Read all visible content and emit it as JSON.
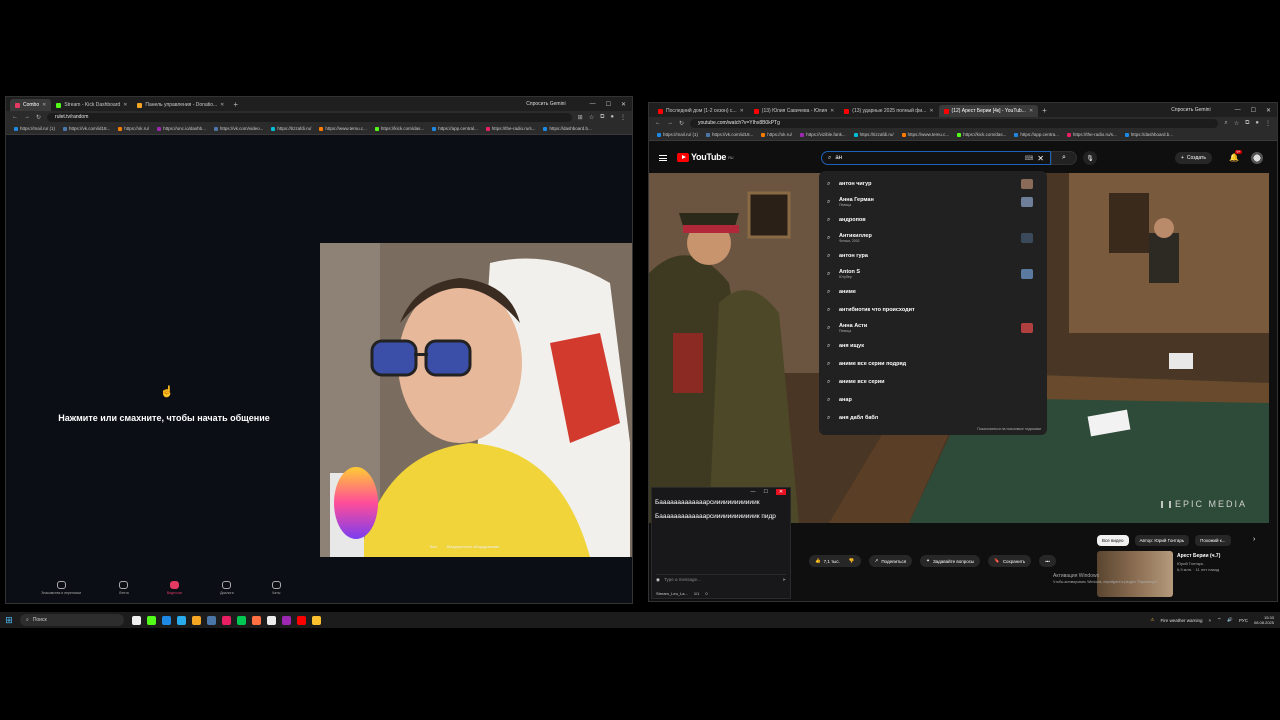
{
  "left_browser": {
    "tabs": [
      {
        "label": "Combo",
        "color": "#e23a63",
        "active": true
      },
      {
        "label": "Stream - Kick Dashboard",
        "color": "#53fc18",
        "active": false
      },
      {
        "label": "Панель управления - Donatio...",
        "color": "#f5a623",
        "active": false
      }
    ],
    "new_tab": "+",
    "gemini": "Спросить Gemini",
    "url": "rulet.tv/random",
    "bookmarks": [
      {
        "label": "https://mail.ru/ (1)",
        "color": "#1e88e5"
      },
      {
        "label": "https://vk.com/id18...",
        "color": "#4a76a8"
      },
      {
        "label": "https://ok.ru/",
        "color": "#f57c00"
      },
      {
        "label": "https://unc.io/dashb...",
        "color": "#9c27b0"
      },
      {
        "label": "https://vk.com/video...",
        "color": "#4a76a8"
      },
      {
        "label": "https://tizzafdi.ru/",
        "color": "#00bcd4"
      },
      {
        "label": "https://www.temu.c...",
        "color": "#ff7a00"
      },
      {
        "label": "https://kick.com/das...",
        "color": "#53fc18"
      },
      {
        "label": "https://app.central...",
        "color": "#1e88e5"
      },
      {
        "label": "https://the-radio.ru/s...",
        "color": "#e91e63"
      },
      {
        "label": "https://dashboard.b...",
        "color": "#1e88e5"
      }
    ],
    "hand_glyph": "☝",
    "prompt": "Нажмите или смахните, чтобы начать общение",
    "nav": [
      {
        "label": "Знакомства и переписки",
        "active": false
      },
      {
        "label": "Лента",
        "active": false
      },
      {
        "label": "Видеочат",
        "active": true
      },
      {
        "label": "Диалоги",
        "active": false
      },
      {
        "label": "Чаты",
        "active": false
      }
    ],
    "cam_pill": [
      "Все",
      "Медицинское оборудование"
    ]
  },
  "right_browser": {
    "tabs": [
      {
        "label": "Последний дом (1-2 сезон) с...",
        "color": "#ff0000",
        "active": false
      },
      {
        "label": "(13) Юлия Савичева - Юлия",
        "color": "#ff0000",
        "active": false
      },
      {
        "label": "(13) ударные 2025 полный фи...",
        "color": "#ff0000",
        "active": false
      },
      {
        "label": "(12) Арест Берии [4к] - YouTub...",
        "color": "#ff0000",
        "active": true
      }
    ],
    "new_tab": "+",
    "gemini": "Спросить Gemini",
    "url": "youtube.com/watch?v=YIhx8B0kPTg",
    "bookmarks": [
      {
        "label": "https://mail.ru/ (1)",
        "color": "#1e88e5"
      },
      {
        "label": "https://vk.com/id18...",
        "color": "#4a76a8"
      },
      {
        "label": "https://ok.ru/",
        "color": "#f57c00"
      },
      {
        "label": "https://vizible.fank...",
        "color": "#9c27b0"
      },
      {
        "label": "https://tizzafdi.ru/",
        "color": "#00bcd4"
      },
      {
        "label": "https://www.temu.c...",
        "color": "#ff7a00"
      },
      {
        "label": "https://kick.com/das...",
        "color": "#53fc18"
      },
      {
        "label": "https://app.centra...",
        "color": "#1e88e5"
      },
      {
        "label": "https://the-radio.ru/s...",
        "color": "#e91e63"
      },
      {
        "label": "https://dashboard.b...",
        "color": "#1e88e5"
      }
    ]
  },
  "youtube": {
    "logo": "YouTube",
    "logo_region": "RU",
    "search_query": "ан",
    "create_label": "Создать",
    "notif_count": "9+",
    "suggestions": [
      {
        "main": "антон чигур",
        "sub": "",
        "thumb": "#8a6b5a"
      },
      {
        "main": "Анна Герман",
        "sub": "Певица",
        "thumb": "#6f7f99"
      },
      {
        "main": "андропов",
        "sub": "",
        "thumb": ""
      },
      {
        "main": "Антикиллер",
        "sub": "Фильм, 2002",
        "thumb": "#3a4a5a"
      },
      {
        "main": "антон гура",
        "sub": "",
        "thumb": ""
      },
      {
        "main": "Anton S",
        "sub": "Ютубер",
        "thumb": "#5a7aa0"
      },
      {
        "main": "аниме",
        "sub": "",
        "thumb": ""
      },
      {
        "main": "антибиотик что происходит",
        "sub": "",
        "thumb": ""
      },
      {
        "main": "Анна Асти",
        "sub": "Певица",
        "thumb": "#b04040"
      },
      {
        "main": "аня ищук",
        "sub": "",
        "thumb": ""
      },
      {
        "main": "аниме все серии подряд",
        "sub": "",
        "thumb": ""
      },
      {
        "main": "аниме все серии",
        "sub": "",
        "thumb": ""
      },
      {
        "main": "анар",
        "sub": "",
        "thumb": ""
      },
      {
        "main": "аня дабл бабл",
        "sub": "",
        "thumb": ""
      }
    ],
    "suggest_footer": "Пожаловаться на поисковые подсказки",
    "watermark": "EPIC MEDIA",
    "actions": {
      "likes": "7,1 тыс.",
      "share": "Поделиться",
      "ask": "Задавайте вопросы",
      "save": "Сохранить",
      "more": "•••"
    },
    "chips": [
      {
        "label": "Все видео",
        "active": true
      },
      {
        "label": "Автор: Юрий Гонтарь",
        "active": false
      },
      {
        "label": "Похожий к...",
        "active": false
      }
    ],
    "recommendation": {
      "title": "Арест Берии (ч.7)",
      "channel": "Юрий Гонтарь",
      "meta": "6,9 млн. · 11 лет назад"
    },
    "activation": {
      "line1": "Активация Windows",
      "line2": "Чтобы активировать Windows, перейдите в раздел \"Параметры\"."
    }
  },
  "chat_popup": {
    "messages": [
      "Бааааааааааааарсиииииииииииик",
      "Бааааааааааааарсиииииииииииик пидр"
    ],
    "input_placeholder": "Type a message...",
    "footer_user": "Stream_Leo_La...",
    "footer_viewers": "1/1",
    "footer_count": "0"
  },
  "taskbar": {
    "search": "Поиск",
    "apps": [
      "#f0f0f0",
      "#53fc18",
      "#1e88e5",
      "#2aabee",
      "#f5a623",
      "#4a76a8",
      "#e91e63",
      "#00c853",
      "#ff7043",
      "#eeeeee",
      "#9c27b0",
      "#ff0000",
      "#fbc02d"
    ],
    "weather": "Fire weather warning",
    "lang": "РУС",
    "time": "15:33",
    "date": "08.08.2025"
  }
}
